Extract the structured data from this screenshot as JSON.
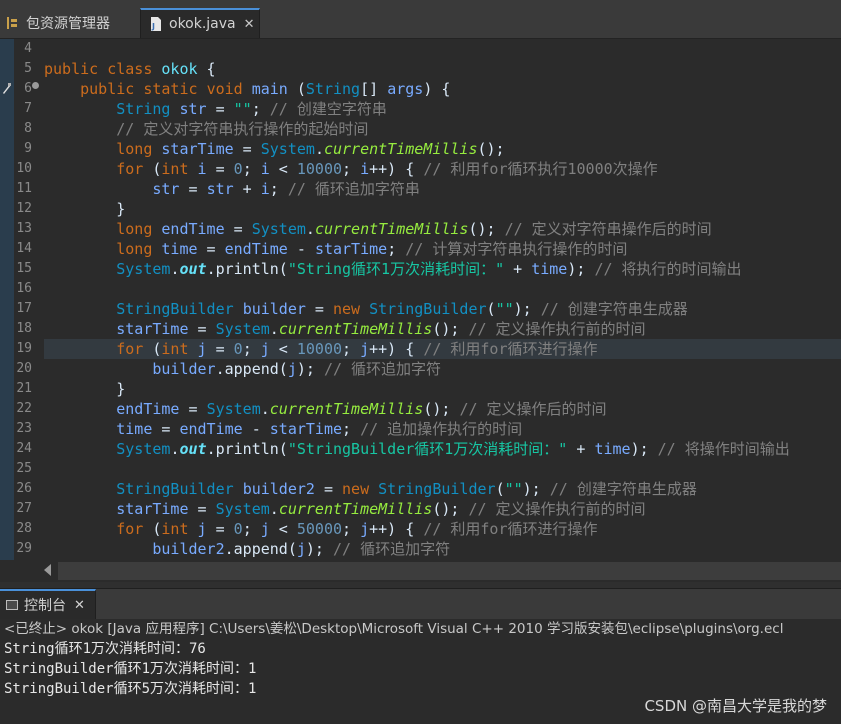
{
  "tabs": [
    {
      "label": "包资源管理器",
      "icon": "package-explorer-icon"
    },
    {
      "label": "okok.java",
      "icon": "java-file-icon",
      "close": "✕"
    }
  ],
  "editor": {
    "line_numbers": [
      "4",
      "5",
      "6",
      "7",
      "8",
      "9",
      "10",
      "11",
      "12",
      "13",
      "14",
      "15",
      "16",
      "17",
      "18",
      "19",
      "20",
      "21",
      "22",
      "23",
      "24",
      "25",
      "26",
      "27",
      "28",
      "29"
    ],
    "highlighted_line": "19"
  },
  "console": {
    "tab_label": "控制台",
    "tab_close": "✕",
    "status": "<已终止> okok [Java 应用程序] C:\\Users\\姜松\\Desktop\\Microsoft Visual C++ 2010 学习版安装包\\eclipse\\plugins\\org.ecl",
    "output": [
      "String循环1万次消耗时间：76",
      "StringBuilder循环1万次消耗时间：1",
      "StringBuilder循环5万次消耗时间：1"
    ]
  },
  "watermark": "CSDN @南昌大学是我的梦"
}
